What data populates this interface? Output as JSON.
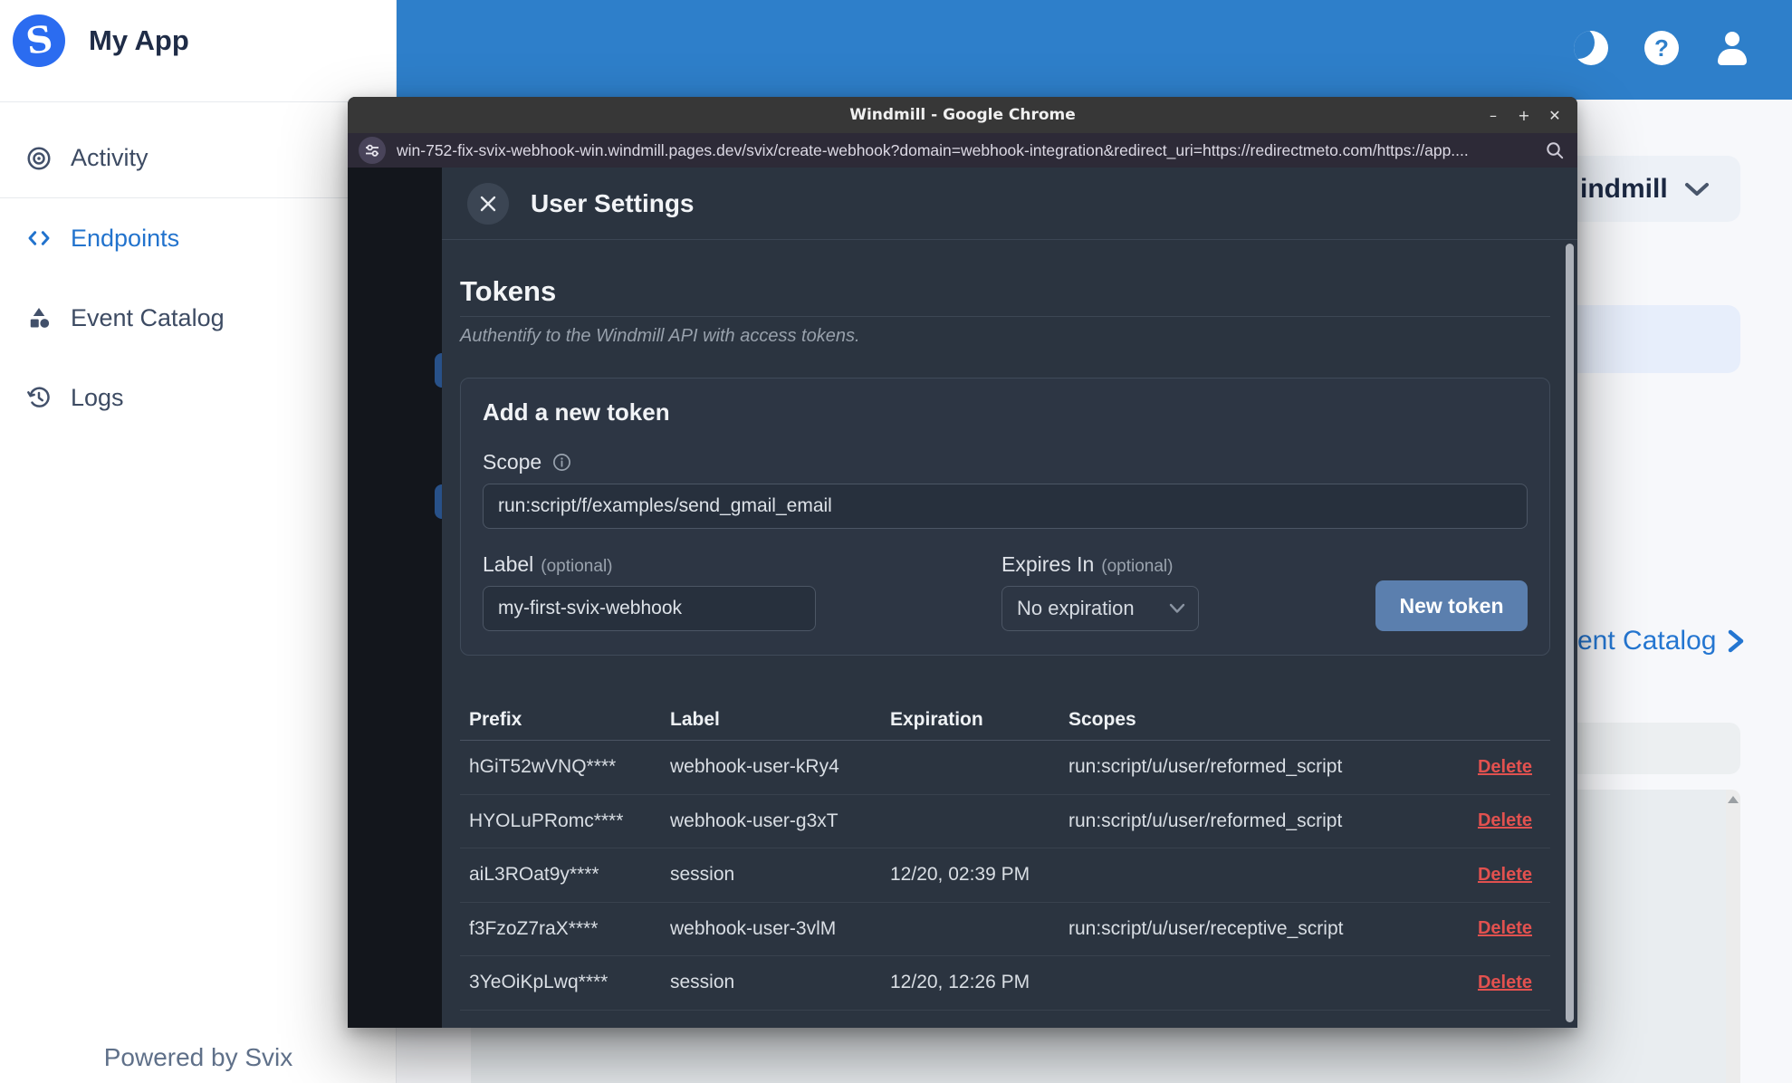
{
  "app": {
    "name": "My App",
    "powered_by": "Powered by Svix",
    "nav": [
      {
        "label": "Activity"
      },
      {
        "label": "Endpoints",
        "active": true
      },
      {
        "label": "Event Catalog"
      },
      {
        "label": "Logs"
      }
    ],
    "help_glyph": "?",
    "background_fragments": {
      "environment_dropdown": "indmill",
      "event_catalog_link": "ent Catalog"
    },
    "colors": {
      "header_blue": "#2e7fca",
      "accent_blue": "#2273cd",
      "logo_blue": "#2b6cf0"
    }
  },
  "browser": {
    "window_title": "Windmill - Google Chrome",
    "controls": {
      "minimize": "–",
      "maximize": "+",
      "close": "✕"
    },
    "url": "win-752-fix-svix-webhook-win.windmill.pages.dev/svix/create-webhook?domain=webhook-integration&redirect_uri=https://redirectmeto.com/https://app...."
  },
  "modal": {
    "title": "User Settings",
    "section": {
      "heading": "Tokens",
      "description": "Authentify to the Windmill API with access tokens."
    },
    "add_token": {
      "heading": "Add a new token",
      "scope_label": "Scope",
      "scope_value": "run:script/f/examples/send_gmail_email",
      "label_label": "Label",
      "optional": "(optional)",
      "label_value": "my-first-svix-webhook",
      "expires_label": "Expires In",
      "expires_value": "No expiration",
      "button_label": "New token",
      "button_color": "#5b7fae"
    },
    "table": {
      "headers": [
        "Prefix",
        "Label",
        "Expiration",
        "Scopes"
      ],
      "delete_label": "Delete",
      "delete_color": "#e2514f",
      "rows": [
        {
          "prefix": "hGiT52wVNQ****",
          "label": "webhook-user-kRy4",
          "expiration": "",
          "scopes": "run:script/u/user/reformed_script"
        },
        {
          "prefix": "HYOLuPRomc****",
          "label": "webhook-user-g3xT",
          "expiration": "",
          "scopes": "run:script/u/user/reformed_script"
        },
        {
          "prefix": "aiL3ROat9y****",
          "label": "session",
          "expiration": "12/20, 02:39 PM",
          "scopes": ""
        },
        {
          "prefix": "f3FzoZ7raX****",
          "label": "webhook-user-3vlM",
          "expiration": "",
          "scopes": "run:script/u/user/receptive_script"
        },
        {
          "prefix": "3YeOiKpLwq****",
          "label": "session",
          "expiration": "12/20, 12:26 PM",
          "scopes": ""
        }
      ]
    }
  }
}
